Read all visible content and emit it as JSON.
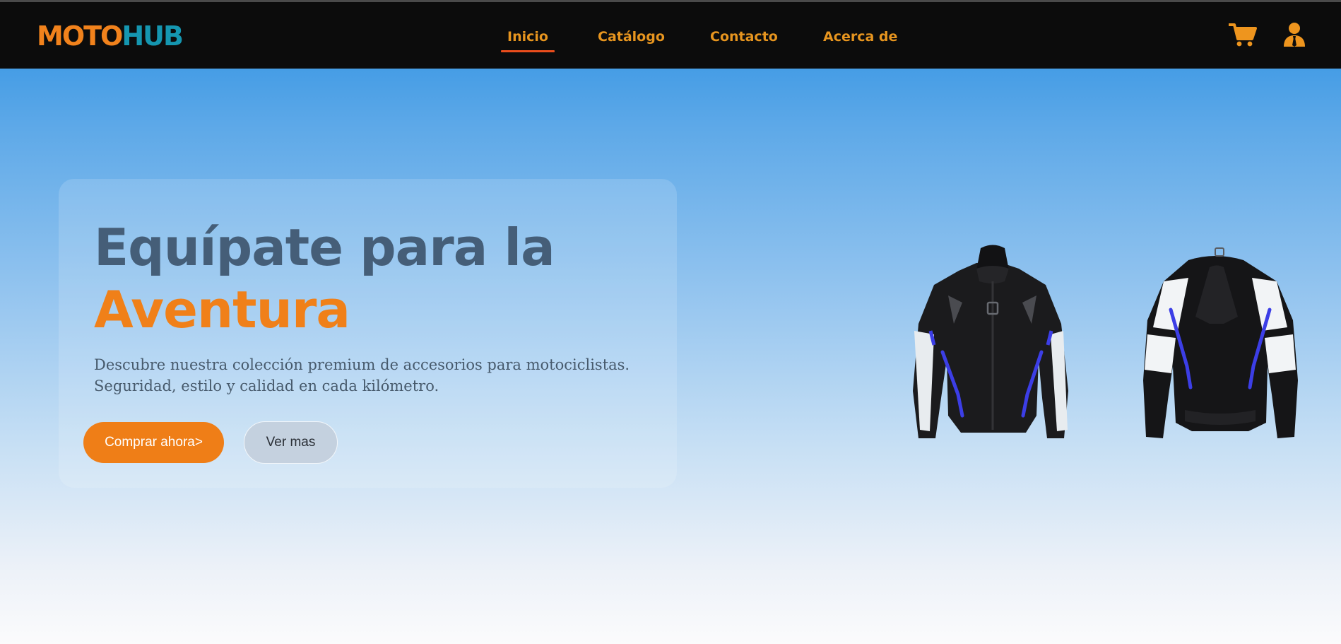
{
  "brand": {
    "part1": "MOTO",
    "part2": "HUB"
  },
  "nav": {
    "links": [
      {
        "label": "Inicio",
        "active": true
      },
      {
        "label": "Catálogo",
        "active": false
      },
      {
        "label": "Contacto",
        "active": false
      },
      {
        "label": "Acerca de",
        "active": false
      }
    ],
    "icons": [
      "shopping-cart-icon",
      "user-account-icon"
    ]
  },
  "hero": {
    "title": "Equípate para la",
    "title_accent": "Aventura",
    "description": "Descubre nuestra colección premium de accesorios para motociclistas. Seguridad, estilo y calidad en cada kilómetro.",
    "primary_button": "Comprar ahora>",
    "secondary_button": "Ver mas",
    "image_subject": "motorcycle-jacket-front-and-back"
  },
  "colors": {
    "brand_orange": "#f1821c",
    "brand_teal": "#1596b0",
    "nav_background": "#0c0c0c",
    "nav_link": "#e7951f",
    "nav_active_underline": "#ea4d1c",
    "title_blue_gray": "#455e78",
    "accent_orange": "#f08019",
    "hero_gradient_top": "#2a8fe2",
    "hero_gradient_bottom": "#fbfbfc"
  }
}
